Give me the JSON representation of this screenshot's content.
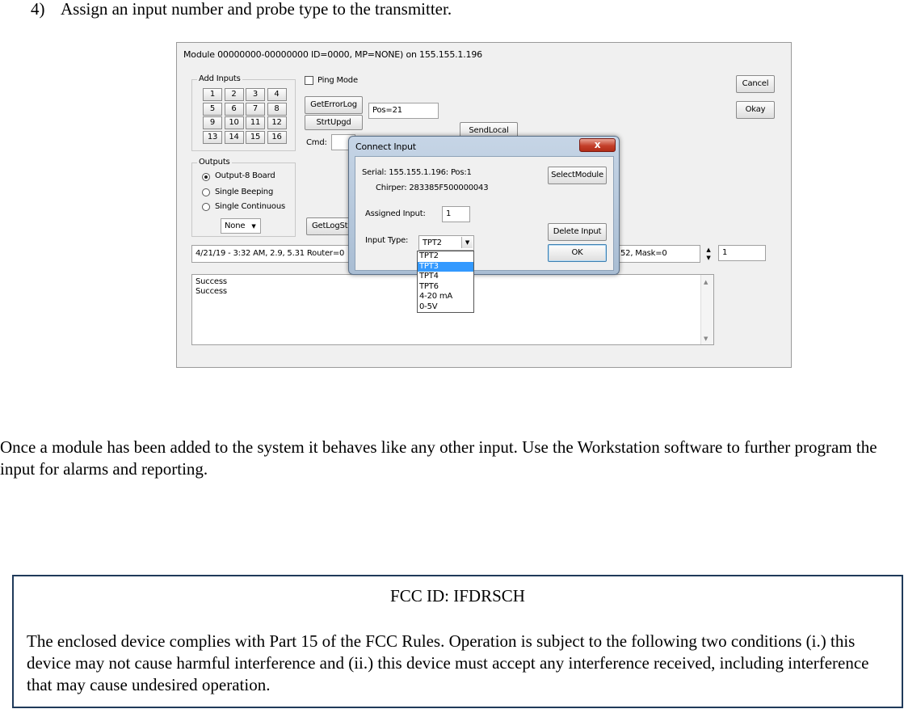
{
  "document": {
    "step_number": "4)",
    "step_text": "Assign an input number and probe type to the transmitter.",
    "paragraph": "Once a module has been added to the system it behaves like any other input.  Use the Workstation software to further program the input for alarms and reporting.",
    "fcc_id": "FCC ID: IFDRSCH",
    "fcc_text": "The enclosed device complies with Part 15 of the FCC Rules.  Operation is subject to the following two conditions (i.) this device may not cause harmful interference and (ii.) this device must accept any interference received, including interference that may cause undesired operation."
  },
  "window": {
    "title": "Module 00000000-00000000 ID=0000, MP=NONE) on 155.155.1.196",
    "add_inputs_label": "Add Inputs",
    "input_buttons": [
      "1",
      "2",
      "3",
      "4",
      "5",
      "6",
      "7",
      "8",
      "9",
      "10",
      "11",
      "12",
      "13",
      "14",
      "15",
      "16"
    ],
    "ping_mode_label": "Ping Mode",
    "get_error_log": "GetErrorLog",
    "pos_value": "Pos=21",
    "strt_upgd": "StrtUpgd",
    "send_local": "SendLocal",
    "cmd_label": "Cmd:",
    "outputs_label": "Outputs",
    "output_options": [
      "Output-8 Board",
      "Single Beeping",
      "Single Continuous"
    ],
    "output_selected_index": 0,
    "none_select": "None",
    "get_log_btn": "GetLogSt",
    "cancel": "Cancel",
    "okay": "Okay",
    "log_left": "4/21/19 -  3:32 AM, 2.9, 5.31 Router=0",
    "log_right": "52, Mask=0",
    "spin_value": "1",
    "status_lines": [
      "Success",
      "Success"
    ]
  },
  "dialog": {
    "title": "Connect Input",
    "close_glyph": "x",
    "serial": "Serial: 155.155.1.196: Pos:1",
    "chirper": "Chirper: 283385F500000043",
    "select_module": "SelectModule",
    "assigned_input_label": "Assigned Input:",
    "assigned_input_value": "1",
    "delete_input": "Delete Input",
    "input_type_label": "Input Type:",
    "input_type_value": "TPT2",
    "ok": "OK",
    "input_type_options": [
      "TPT2",
      "TPT3",
      "TPT4",
      "TPT6",
      "4-20 mA",
      "0-5V"
    ],
    "input_type_highlighted_index": 1
  },
  "colors": {
    "dropdown_highlight": "#3399ff",
    "close_button": "#c4402b",
    "fcc_border": "#1f3a5a"
  }
}
